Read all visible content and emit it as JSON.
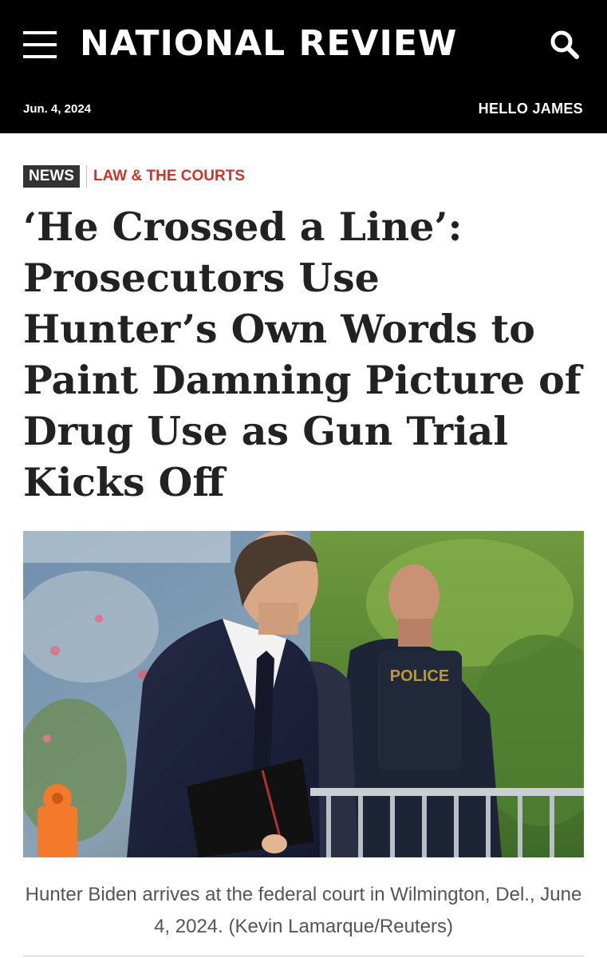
{
  "header": {
    "brand": "NATIONAL REVIEW",
    "menu_icon": "hamburger-menu-icon",
    "search_icon": "search-icon",
    "date": "Jun. 4, 2024",
    "greeting": "HELLO JAMES",
    "background": "#000000"
  },
  "article": {
    "section_tag": "NEWS",
    "category_tag": "LAW & THE COURTS",
    "category_color": "#c8372d",
    "headline": "‘He Crossed a Line’: Prosecutors Use Hunter’s Own Words to Paint Damning Picture of Drug Use as Gun Trial Kicks Off",
    "photo_caption": "Hunter Biden arrives at the federal court in Wilmington, Del., June 4, 2024. (Kevin Lamarque/Reuters)",
    "photo_vest_text": "POLICE"
  }
}
